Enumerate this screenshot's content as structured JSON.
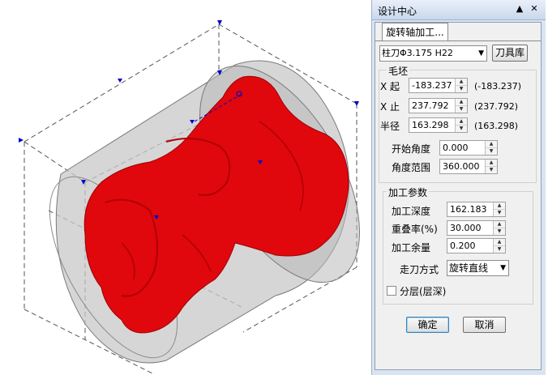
{
  "panel": {
    "title": "设计中心",
    "pin_glyph": "▲",
    "close_glyph": "✕",
    "tab_label": "旋转轴加工...",
    "tool": {
      "value": "柱刀Φ3.175 H22",
      "library_button": "刀具库"
    },
    "blank": {
      "title": "毛坯",
      "x_start": {
        "label": "X 起",
        "value": "-183.237",
        "readout": "(-183.237)"
      },
      "x_end": {
        "label": "X 止",
        "value": "237.792",
        "readout": "(237.792)"
      },
      "radius": {
        "label": "半径",
        "value": "163.298",
        "readout": "(163.298)"
      },
      "start_angle": {
        "label": "开始角度",
        "value": "0.000"
      },
      "angle_range": {
        "label": "角度范围",
        "value": "360.000"
      }
    },
    "machining": {
      "title": "加工参数",
      "depth": {
        "label": "加工深度",
        "value": "162.183"
      },
      "overlap": {
        "label": "重叠率(%)",
        "value": "30.000"
      },
      "allowance": {
        "label": "加工余量",
        "value": "0.200"
      },
      "toolpath": {
        "label": "走刀方式",
        "value": "旋转直线"
      },
      "layered": {
        "label": "分层(层深)",
        "checked": false
      }
    },
    "ok": "确定",
    "cancel": "取消"
  },
  "colors": {
    "model": "#e0080c",
    "cylinder": "#c8c8c8",
    "panel_bg": "#d9e4f2",
    "marker": "#0000cc"
  }
}
